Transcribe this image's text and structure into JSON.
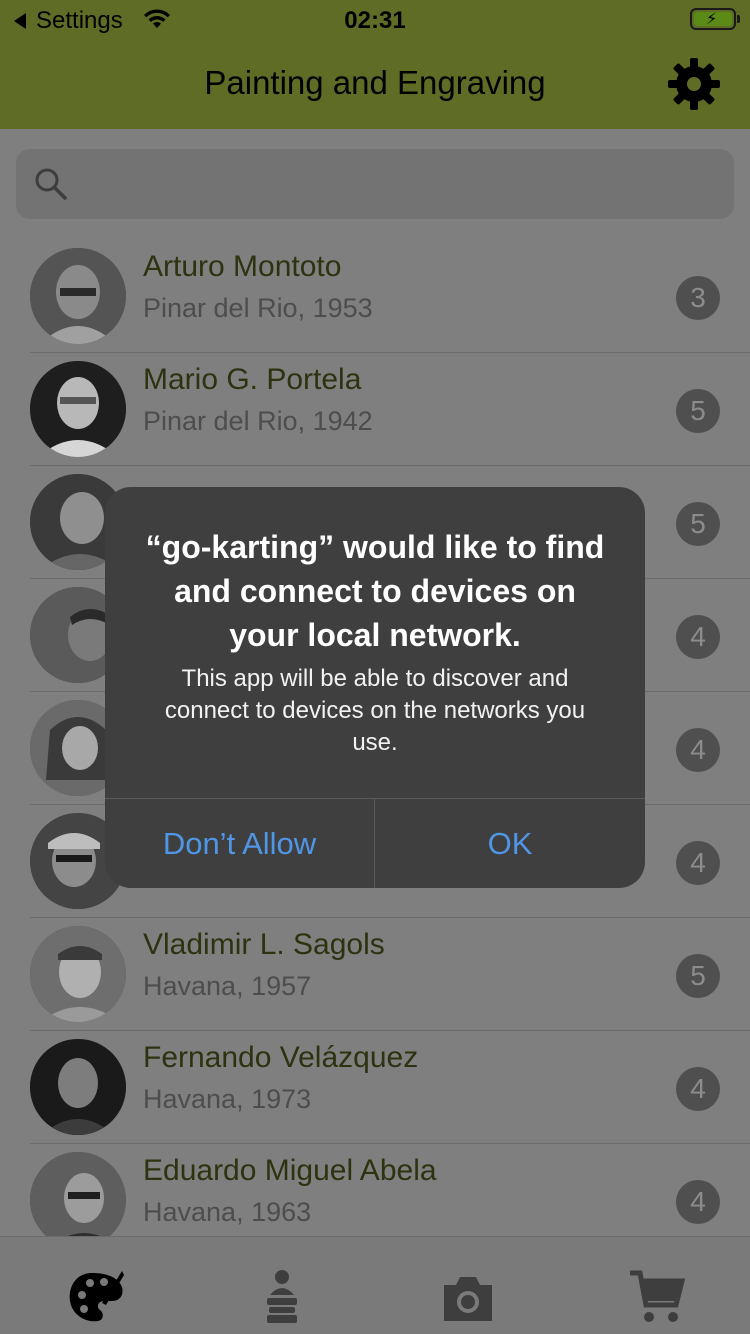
{
  "status_bar": {
    "back_label": "Settings",
    "time": "02:31",
    "battery_color": "#5b8a17"
  },
  "nav": {
    "title": "Painting and Engraving",
    "settings_icon": "gear-icon"
  },
  "search": {
    "placeholder": ""
  },
  "artists": [
    {
      "name": "Arturo Montoto",
      "origin": "Pinar del Rio, 1953",
      "count": "3"
    },
    {
      "name": "Mario G. Portela",
      "origin": "Pinar del Rio, 1942",
      "count": "5"
    },
    {
      "name": "",
      "origin": "",
      "count": "5"
    },
    {
      "name": "",
      "origin": "",
      "count": "4"
    },
    {
      "name": "",
      "origin": "",
      "count": "4"
    },
    {
      "name": "",
      "origin": "",
      "count": "4"
    },
    {
      "name": "Vladimir L. Sagols",
      "origin": "Havana, 1957",
      "count": "5"
    },
    {
      "name": "Fernando Velázquez",
      "origin": "Havana, 1973",
      "count": "4"
    },
    {
      "name": "Eduardo Miguel Abela",
      "origin": "Havana, 1963",
      "count": "4"
    }
  ],
  "tabs": [
    {
      "icon": "palette-icon",
      "active": true
    },
    {
      "icon": "person-stack-icon",
      "active": false
    },
    {
      "icon": "camera-icon",
      "active": false
    },
    {
      "icon": "cart-icon",
      "active": false
    }
  ],
  "alert": {
    "title": "“go-karting” would like to find and connect to devices on your local network.",
    "message": "This app will be able to discover and connect to devices on the networks you use.",
    "deny_label": "Don’t Allow",
    "ok_label": "OK"
  },
  "colors": {
    "accent": "#5f6c26",
    "alert_button": "#4f97e6"
  }
}
